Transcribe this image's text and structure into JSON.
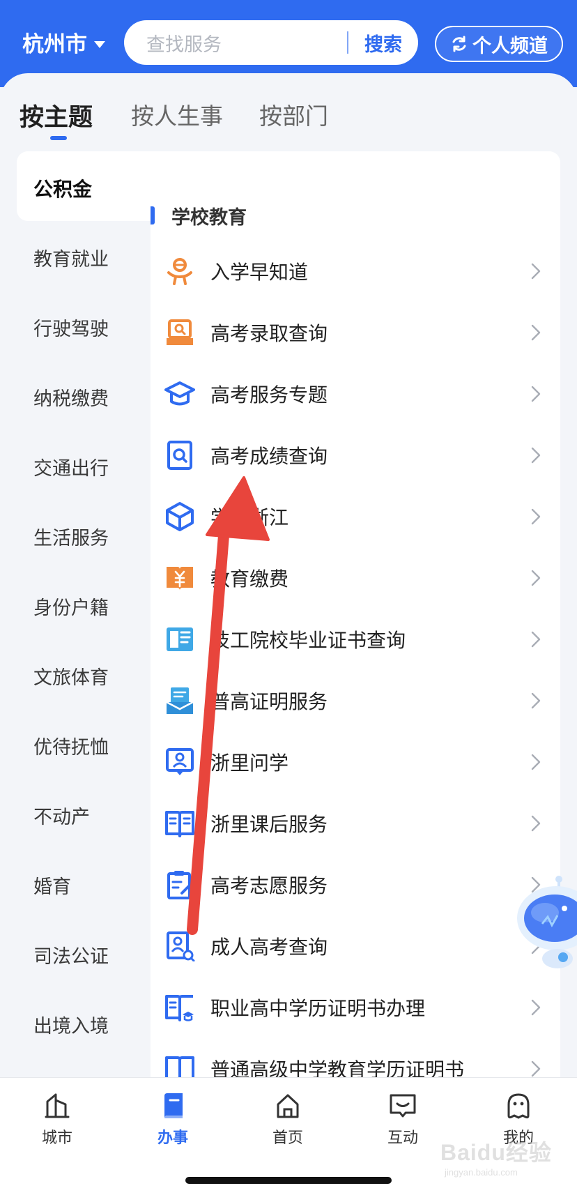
{
  "header": {
    "city": "杭州市",
    "search_placeholder": "查找服务",
    "search_button": "搜索",
    "personal_channel": "个人频道"
  },
  "tabs": [
    {
      "label": "按主题",
      "active": true
    },
    {
      "label": "按人生事",
      "active": false
    },
    {
      "label": "按部门",
      "active": false
    }
  ],
  "categories": [
    {
      "label": "公积金",
      "active": true
    },
    {
      "label": "教育就业",
      "active": false
    },
    {
      "label": "行驶驾驶",
      "active": false
    },
    {
      "label": "纳税缴费",
      "active": false
    },
    {
      "label": "交通出行",
      "active": false
    },
    {
      "label": "生活服务",
      "active": false
    },
    {
      "label": "身份户籍",
      "active": false
    },
    {
      "label": "文旅体育",
      "active": false
    },
    {
      "label": "优待抚恤",
      "active": false
    },
    {
      "label": "不动产",
      "active": false
    },
    {
      "label": "婚育",
      "active": false
    },
    {
      "label": "司法公证",
      "active": false
    },
    {
      "label": "出境入境",
      "active": false
    }
  ],
  "section": {
    "title": "学校教育",
    "items": [
      {
        "label": "入学早知道",
        "icon": "enrollment-icon"
      },
      {
        "label": "高考录取查询",
        "icon": "admission-query-icon"
      },
      {
        "label": "高考服务专题",
        "icon": "graduation-cap-icon"
      },
      {
        "label": "高考成绩查询",
        "icon": "score-query-icon"
      },
      {
        "label": "学在浙江",
        "icon": "cube-icon"
      },
      {
        "label": "教育缴费",
        "icon": "education-payment-icon"
      },
      {
        "label": "技工院校毕业证书查询",
        "icon": "certificate-book-icon"
      },
      {
        "label": "普高证明服务",
        "icon": "proof-service-icon"
      },
      {
        "label": "浙里问学",
        "icon": "ask-study-icon"
      },
      {
        "label": "浙里课后服务",
        "icon": "after-school-icon"
      },
      {
        "label": "高考志愿服务",
        "icon": "application-edit-icon"
      },
      {
        "label": "成人高考查询",
        "icon": "adult-exam-icon"
      },
      {
        "label": "职业高中学历证明书办理",
        "icon": "vocational-cert-icon"
      },
      {
        "label": "普通高级中学教育学历证明书",
        "icon": "highschool-cert-icon"
      }
    ]
  },
  "bottom_nav": [
    {
      "label": "城市",
      "icon": "city-icon",
      "active": false
    },
    {
      "label": "办事",
      "icon": "services-icon",
      "active": true
    },
    {
      "label": "首页",
      "icon": "home-icon",
      "active": false
    },
    {
      "label": "互动",
      "icon": "interact-icon",
      "active": false
    },
    {
      "label": "我的",
      "icon": "profile-icon",
      "active": false
    }
  ],
  "watermark": {
    "main": "Baidu经验",
    "sub": "jingyan.baidu.com"
  },
  "colors": {
    "primary": "#2f6bf0",
    "annotation_arrow": "#e8453c"
  }
}
